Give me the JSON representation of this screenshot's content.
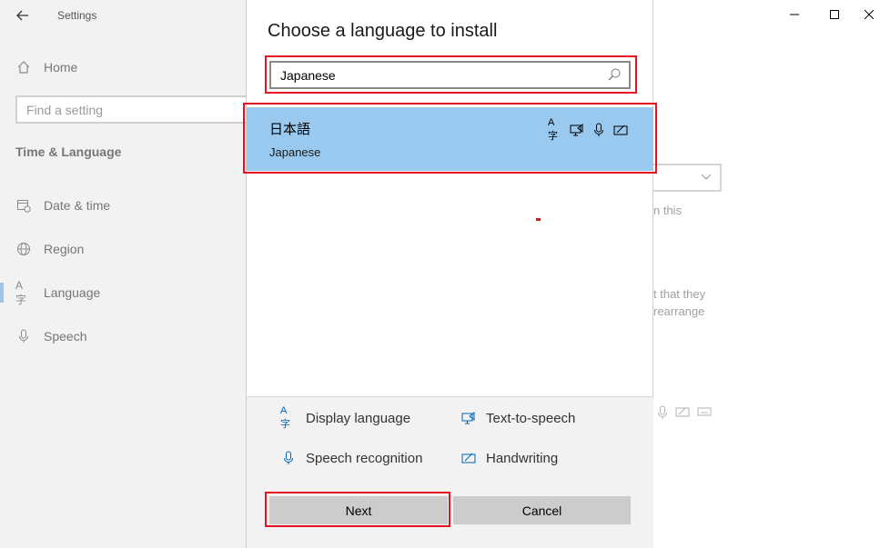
{
  "window": {
    "title": "Settings"
  },
  "sidebar": {
    "home_label": "Home",
    "search_placeholder": "Find a setting",
    "section_title": "Time & Language",
    "items": [
      {
        "label": "Date & time",
        "icon": "calendar-clock-icon"
      },
      {
        "label": "Region",
        "icon": "globe-icon"
      },
      {
        "label": "Language",
        "icon": "language-icon",
        "active": true
      },
      {
        "label": "Speech",
        "icon": "microphone-icon"
      }
    ]
  },
  "background": {
    "text_1": "n this",
    "text_2": "t that they",
    "text_3": "rearrange"
  },
  "dialog": {
    "title": "Choose a language to install",
    "search_value": "Japanese",
    "result": {
      "native_name": "日本語",
      "english_name": "Japanese",
      "selected": true
    },
    "legend": [
      {
        "label": "Display language",
        "icon": "display-language-icon"
      },
      {
        "label": "Text-to-speech",
        "icon": "text-to-speech-icon"
      },
      {
        "label": "Speech recognition",
        "icon": "speech-recognition-icon"
      },
      {
        "label": "Handwriting",
        "icon": "handwriting-icon"
      }
    ],
    "next_label": "Next",
    "cancel_label": "Cancel"
  },
  "colors": {
    "selection": "#99c9ef",
    "highlight": "#e81123",
    "accent_icon": "#0063b1"
  }
}
